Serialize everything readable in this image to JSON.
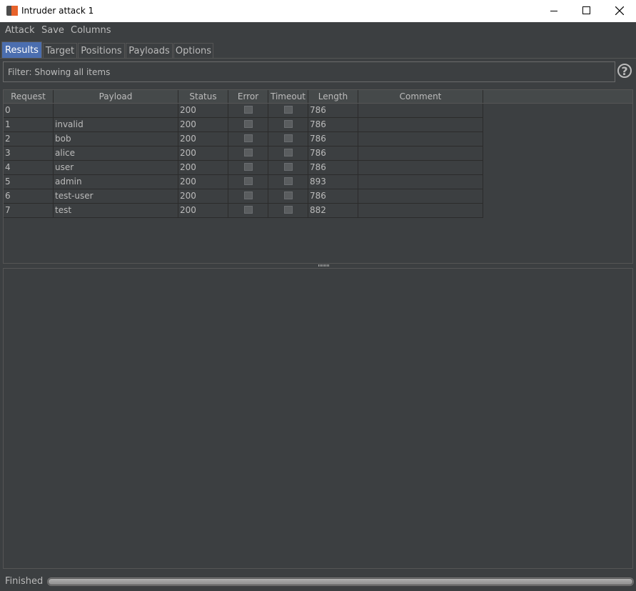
{
  "window": {
    "title": "Intruder attack 1"
  },
  "menu": [
    "Attack",
    "Save",
    "Columns"
  ],
  "tabs": [
    "Results",
    "Target",
    "Positions",
    "Payloads",
    "Options"
  ],
  "active_tab": "Results",
  "filter": {
    "text": "Filter: Showing all items"
  },
  "table": {
    "columns": [
      "Request",
      "Payload",
      "Status",
      "Error",
      "Timeout",
      "Length",
      "Comment"
    ],
    "rows": [
      {
        "request": "0",
        "payload": "",
        "status": "200",
        "error": false,
        "timeout": false,
        "length": "786",
        "comment": ""
      },
      {
        "request": "1",
        "payload": "invalid",
        "status": "200",
        "error": false,
        "timeout": false,
        "length": "786",
        "comment": ""
      },
      {
        "request": "2",
        "payload": "bob",
        "status": "200",
        "error": false,
        "timeout": false,
        "length": "786",
        "comment": ""
      },
      {
        "request": "3",
        "payload": "alice",
        "status": "200",
        "error": false,
        "timeout": false,
        "length": "786",
        "comment": ""
      },
      {
        "request": "4",
        "payload": "user",
        "status": "200",
        "error": false,
        "timeout": false,
        "length": "786",
        "comment": ""
      },
      {
        "request": "5",
        "payload": "admin",
        "status": "200",
        "error": false,
        "timeout": false,
        "length": "893",
        "comment": ""
      },
      {
        "request": "6",
        "payload": "test-user",
        "status": "200",
        "error": false,
        "timeout": false,
        "length": "786",
        "comment": ""
      },
      {
        "request": "7",
        "payload": "test",
        "status": "200",
        "error": false,
        "timeout": false,
        "length": "882",
        "comment": ""
      }
    ]
  },
  "status": {
    "text": "Finished",
    "progress": 1.0
  },
  "colors": {
    "background": "#3c3f41",
    "active_tab": "#4b6eaf",
    "text": "#bbbbbb"
  },
  "icons": {
    "help": "help-icon",
    "app": "burp-icon"
  }
}
